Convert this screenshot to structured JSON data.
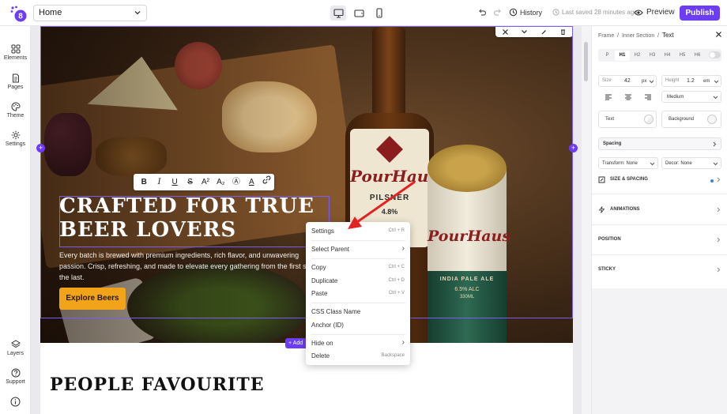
{
  "topbar": {
    "page_value": "Home",
    "history_label": "History",
    "saved_text": "Last saved 28 minutes ago",
    "preview_label": "Preview",
    "publish_label": "Publish",
    "logo_digit": "8"
  },
  "sidebar": {
    "top_items": [
      {
        "label": "Elements",
        "icon": "grid-icon"
      },
      {
        "label": "Pages",
        "icon": "page-icon"
      },
      {
        "label": "Theme",
        "icon": "palette-icon"
      },
      {
        "label": "Settings",
        "icon": "gear-icon"
      }
    ],
    "bottom_items": [
      {
        "label": "Layers",
        "icon": "layers-icon"
      },
      {
        "label": "Support",
        "icon": "help-icon"
      },
      {
        "label": "",
        "icon": "info-icon"
      }
    ]
  },
  "hero": {
    "heading": "CRAFTED FOR TRUE BEER LOVERS",
    "paragraph": "Every batch is brewed with premium ingredients, rich flavor, and unwavering passion. Crisp, refreshing, and made to elevate every gathering from the first s to the last.",
    "cta": "Explore Beers",
    "bottle_brand": "PourHaus",
    "bottle_kind": "PILSNER",
    "bottle_abv": "4.8%",
    "can_brand": "PourHaus",
    "can_kind": "INDIA PALE ALE",
    "can_abv": "6.5% ALC",
    "can_vol": "330ML"
  },
  "add_section_label": "+ Add",
  "lower": {
    "heading": "PEOPLE FAVOURITE"
  },
  "format_toolbar": [
    "B",
    "I",
    "U",
    "S",
    "A²",
    "A₂",
    "Ⓐ",
    "A",
    "link"
  ],
  "context_menu": {
    "items": [
      {
        "label": "Settings",
        "shortcut": "Ctrl + R"
      },
      {
        "label": "Select Parent",
        "shortcut": "›"
      },
      {
        "label": "Copy",
        "shortcut": "Ctrl + C"
      },
      {
        "label": "Duplicate",
        "shortcut": "Ctrl + D"
      },
      {
        "label": "Paste",
        "shortcut": "Ctrl + V"
      },
      {
        "label": "CSS Class Name",
        "shortcut": ""
      },
      {
        "label": "Anchor (ID)",
        "shortcut": ""
      },
      {
        "label": "Hide on",
        "shortcut": "›"
      },
      {
        "label": "Delete",
        "shortcut": "Backspace"
      }
    ]
  },
  "rpanel": {
    "breadcrumb": [
      "Frame",
      "Inner Section",
      "Text"
    ],
    "tags": [
      "P",
      "H1",
      "H2",
      "H3",
      "H4",
      "H5",
      "H6"
    ],
    "active_tag": "H1",
    "size_label": "Size",
    "size_value": "42",
    "size_unit": "px",
    "height_label": "Height",
    "height_value": "1.2",
    "height_unit": "em",
    "weight_value": "Medium",
    "text_label": "Text",
    "background_label": "Background",
    "spacing_label": "Spacing",
    "transform_value": "Transform: None",
    "decor_value": "Decor: None",
    "sections": [
      "SIZE & SPACING",
      "ANIMATIONS",
      "POSITION",
      "STICKY"
    ]
  },
  "colors": {
    "accent": "#6c3df4",
    "cta": "#f1a31a"
  }
}
